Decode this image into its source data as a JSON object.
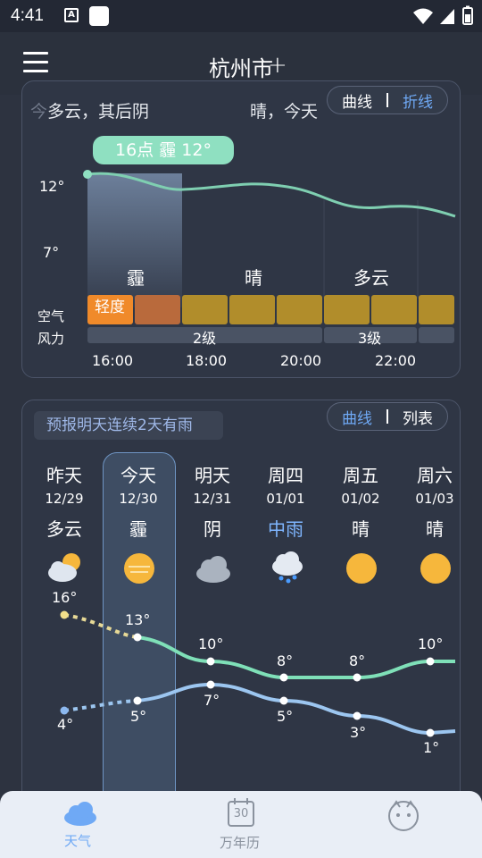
{
  "status_bar": {
    "time": "4:41",
    "notif_icon": "A"
  },
  "header": {
    "city": "杭州市",
    "add_symbol": "+"
  },
  "hourly": {
    "summary_left": "多云，其后阴",
    "summary_right": "晴，今天",
    "toggle": [
      "曲线",
      "折线"
    ],
    "now_badge": "16点 霾 12°",
    "y_labels": [
      "12°",
      "7°"
    ],
    "conditions": [
      "霾",
      "晴",
      "多云"
    ],
    "air_label": "空气",
    "wind_label": "风力",
    "air_quality": "轻度",
    "wind_levels": [
      "2级",
      "3级"
    ],
    "hours": [
      "16:00",
      "18:00",
      "20:00",
      "22:00"
    ]
  },
  "daily": {
    "tip": "预报明天连续2天有雨",
    "toggle": [
      "曲线",
      "列表"
    ],
    "days": [
      {
        "name": "昨天",
        "date": "12/29",
        "cond": "多云",
        "icon": "partly-cloudy-icon",
        "high": "16°",
        "low": "4°"
      },
      {
        "name": "今天",
        "date": "12/30",
        "cond": "霾",
        "icon": "haze-icon",
        "high": "13°",
        "low": "5°"
      },
      {
        "name": "明天",
        "date": "12/31",
        "cond": "阴",
        "icon": "overcast-icon",
        "high": "10°",
        "low": "7°"
      },
      {
        "name": "周四",
        "date": "01/01",
        "cond": "中雨",
        "icon": "moderate-rain-icon",
        "high": "8°",
        "low": "5°"
      },
      {
        "name": "周五",
        "date": "01/02",
        "cond": "晴",
        "icon": "sunny-icon",
        "high": "8°",
        "low": "3°"
      },
      {
        "name": "周六",
        "date": "01/03",
        "cond": "晴",
        "icon": "sunny-icon",
        "high": "10°",
        "low": "1°"
      }
    ]
  },
  "bottom_nav": {
    "items": [
      {
        "label": "天气",
        "icon": "cloud-icon"
      },
      {
        "label": "万年历",
        "icon": "calendar-icon",
        "day": "30"
      },
      {
        "label": "",
        "icon": "mascot-icon"
      }
    ]
  },
  "colors": {
    "accent": "#6fa9f5",
    "rain": "#7fb6ff",
    "high_line": "#7fe0b8",
    "low_line": "#9cc6f0",
    "background": "#2d3340"
  }
}
